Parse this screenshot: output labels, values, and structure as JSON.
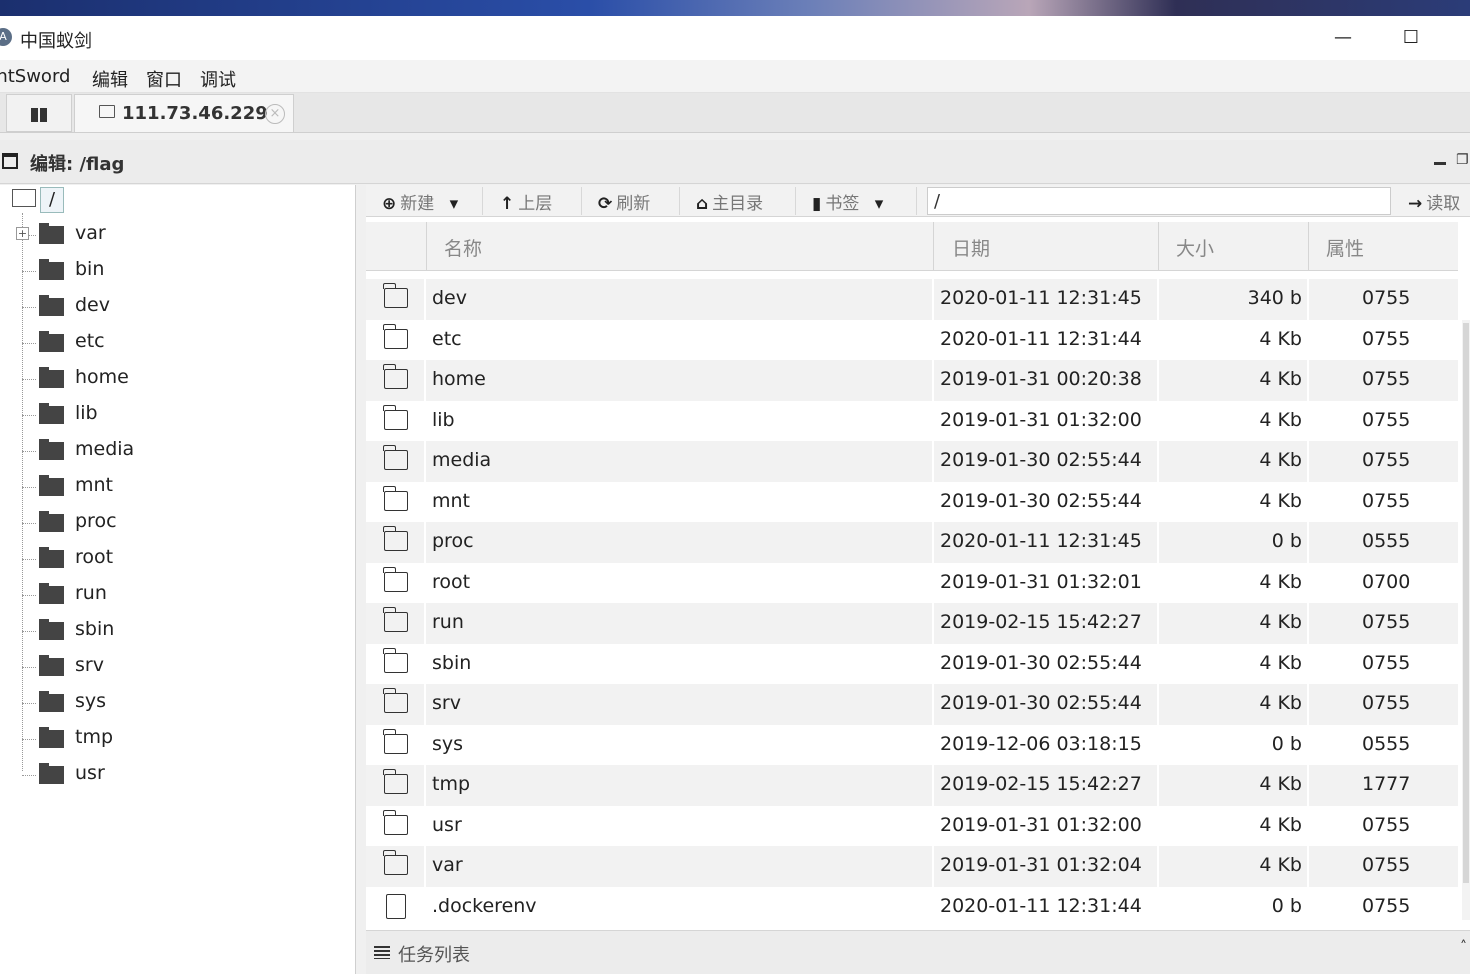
{
  "window": {
    "title": "中国蚁剑",
    "minimize": "—",
    "maximize": "☐"
  },
  "menu": [
    "AntSword",
    "编辑",
    "窗口",
    "调试"
  ],
  "tabs": {
    "host_label": "111.73.46.229",
    "close": "×"
  },
  "panel": {
    "title": "编辑: /flag",
    "restore": "❐"
  },
  "tree": {
    "root_label": "/",
    "expand_glyph": "+",
    "items": [
      "var",
      "bin",
      "dev",
      "etc",
      "home",
      "lib",
      "media",
      "mnt",
      "proc",
      "root",
      "run",
      "sbin",
      "srv",
      "sys",
      "tmp",
      "usr"
    ]
  },
  "toolbar": {
    "new": "新建",
    "up": "上层",
    "refresh": "刷新",
    "home": "主目录",
    "bookmark": "书签",
    "path_value": "/",
    "read": "读取"
  },
  "grid": {
    "columns": [
      "名称",
      "日期",
      "大小",
      "属性"
    ],
    "rows": [
      {
        "name": "dev",
        "date": "2020-01-11 12:31:45",
        "size": "340 b",
        "perm": "0755",
        "type": "folder"
      },
      {
        "name": "etc",
        "date": "2020-01-11 12:31:44",
        "size": "4 Kb",
        "perm": "0755",
        "type": "folder"
      },
      {
        "name": "home",
        "date": "2019-01-31 00:20:38",
        "size": "4 Kb",
        "perm": "0755",
        "type": "folder"
      },
      {
        "name": "lib",
        "date": "2019-01-31 01:32:00",
        "size": "4 Kb",
        "perm": "0755",
        "type": "folder"
      },
      {
        "name": "media",
        "date": "2019-01-30 02:55:44",
        "size": "4 Kb",
        "perm": "0755",
        "type": "folder"
      },
      {
        "name": "mnt",
        "date": "2019-01-30 02:55:44",
        "size": "4 Kb",
        "perm": "0755",
        "type": "folder"
      },
      {
        "name": "proc",
        "date": "2020-01-11 12:31:45",
        "size": "0 b",
        "perm": "0555",
        "type": "folder"
      },
      {
        "name": "root",
        "date": "2019-01-31 01:32:01",
        "size": "4 Kb",
        "perm": "0700",
        "type": "folder"
      },
      {
        "name": "run",
        "date": "2019-02-15 15:42:27",
        "size": "4 Kb",
        "perm": "0755",
        "type": "folder"
      },
      {
        "name": "sbin",
        "date": "2019-01-30 02:55:44",
        "size": "4 Kb",
        "perm": "0755",
        "type": "folder"
      },
      {
        "name": "srv",
        "date": "2019-01-30 02:55:44",
        "size": "4 Kb",
        "perm": "0755",
        "type": "folder"
      },
      {
        "name": "sys",
        "date": "2019-12-06 03:18:15",
        "size": "0 b",
        "perm": "0555",
        "type": "folder"
      },
      {
        "name": "tmp",
        "date": "2019-02-15 15:42:27",
        "size": "4 Kb",
        "perm": "1777",
        "type": "folder"
      },
      {
        "name": "usr",
        "date": "2019-01-31 01:32:00",
        "size": "4 Kb",
        "perm": "0755",
        "type": "folder"
      },
      {
        "name": "var",
        "date": "2019-01-31 01:32:04",
        "size": "4 Kb",
        "perm": "0755",
        "type": "folder"
      },
      {
        "name": ".dockerenv",
        "date": "2020-01-11 12:31:44",
        "size": "0 b",
        "perm": "0755",
        "type": "file"
      }
    ]
  },
  "taskbar": {
    "label": "任务列表",
    "collapse": "˄"
  },
  "colors": {
    "row_alt": "#f2f2f2",
    "header_bg": "#f2f2f2",
    "text": "#222222"
  }
}
